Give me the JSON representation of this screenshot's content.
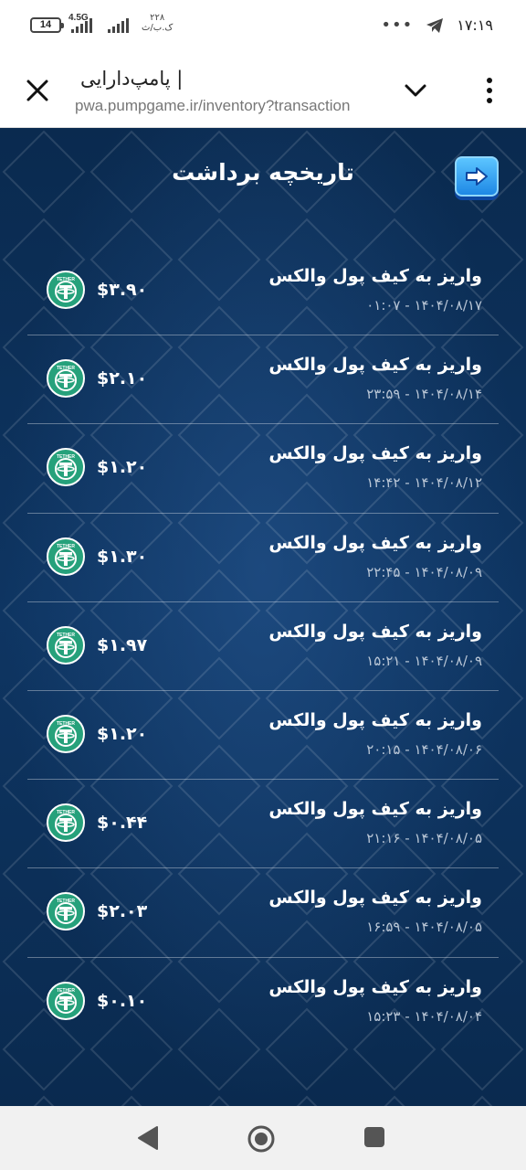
{
  "status_bar": {
    "battery": "14",
    "network": "4.5G",
    "speed_value": "۲۲۸",
    "speed_unit": "ک.ب/ث",
    "more": "•••",
    "time": "۱۷:۱۹"
  },
  "browser": {
    "title": "| پامپ‌دارایی",
    "url": "pwa.pumpgame.ir/inventory?transaction"
  },
  "page": {
    "heading": "تاریخچه برداشت"
  },
  "transactions": [
    {
      "title": "واریز به کیف پول والکس",
      "date": "۱۴۰۴/۰۸/۱۷ - ۰۱:۰۷",
      "amount": "$۳.۹۰"
    },
    {
      "title": "واریز به کیف پول والکس",
      "date": "۱۴۰۴/۰۸/۱۴ - ۲۳:۵۹",
      "amount": "$۲.۱۰"
    },
    {
      "title": "واریز به کیف پول والکس",
      "date": "۱۴۰۴/۰۸/۱۲ - ۱۴:۴۲",
      "amount": "$۱.۲۰"
    },
    {
      "title": "واریز به کیف پول والکس",
      "date": "۱۴۰۴/۰۸/۰۹ - ۲۲:۴۵",
      "amount": "$۱.۳۰"
    },
    {
      "title": "واریز به کیف پول والکس",
      "date": "۱۴۰۴/۰۸/۰۹ - ۱۵:۲۱",
      "amount": "$۱.۹۷"
    },
    {
      "title": "واریز به کیف پول والکس",
      "date": "۱۴۰۴/۰۸/۰۶ - ۲۰:۱۵",
      "amount": "$۱.۲۰"
    },
    {
      "title": "واریز به کیف پول والکس",
      "date": "۱۴۰۴/۰۸/۰۵ - ۲۱:۱۶",
      "amount": "$۰.۴۴"
    },
    {
      "title": "واریز به کیف پول والکس",
      "date": "۱۴۰۴/۰۸/۰۵ - ۱۶:۵۹",
      "amount": "$۲.۰۳"
    },
    {
      "title": "واریز به کیف پول والکس",
      "date": "۱۴۰۴/۰۸/۰۴ - ۱۵:۲۳",
      "amount": "$۰.۱۰"
    }
  ],
  "token_icon": {
    "name": "tether-icon",
    "label": "TETHER",
    "color": "#26a17b"
  },
  "colors": {
    "background": "#0a2a4f",
    "accent": "#1e88e5",
    "tether": "#26a17b"
  }
}
